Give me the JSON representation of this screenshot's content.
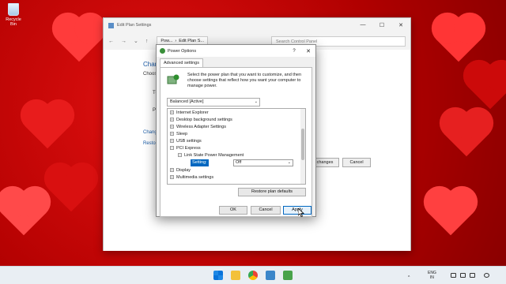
{
  "desktop": {
    "recycle_bin_label": "Recycle Bin"
  },
  "back_window": {
    "title": "Edit Plan Settings",
    "breadcrumb": [
      "Pow...",
      "Edit Plan S..."
    ],
    "nav_back": "←",
    "nav_forward": "→",
    "nav_down": "⌄",
    "nav_up": "↑",
    "search_placeholder": "Search Control Panel",
    "heading_partial": "Chan",
    "choose_partial": "Choos",
    "row1_partial": "Tu",
    "row2_partial": "Pu",
    "link1_partial": "Chang",
    "link2_partial": "Resto",
    "save_partial": "changes",
    "cancel": "Cancel",
    "min": "—",
    "max": "☐",
    "close": "✕"
  },
  "dialog": {
    "title": "Power Options",
    "help": "?",
    "close": "✕",
    "tab": "Advanced settings",
    "description": "Select the power plan that you want to customize, and then choose settings that reflect how you want your computer to manage power.",
    "plan": "Balanced [Active]",
    "tree": [
      {
        "exp": "+",
        "label": "Internet Explorer"
      },
      {
        "exp": "+",
        "label": "Desktop background settings"
      },
      {
        "exp": "+",
        "label": "Wireless Adapter Settings"
      },
      {
        "exp": "+",
        "label": "Sleep"
      },
      {
        "exp": "+",
        "label": "USB settings"
      },
      {
        "exp": "−",
        "label": "PCI Express"
      },
      {
        "exp": "−",
        "label": "Link State Power Management"
      },
      {
        "exp": "+",
        "label": "Display"
      },
      {
        "exp": "+",
        "label": "Multimedia settings"
      }
    ],
    "setting_label": "Setting:",
    "setting_value": "Off",
    "restore": "Restore plan defaults",
    "ok": "OK",
    "cancel": "Cancel",
    "apply": "Apply"
  },
  "taskbar": {
    "lang_top": "ENG",
    "lang_bottom": "IN"
  },
  "colors": {
    "accent": "#0067c0",
    "wallpaper": "#c80000"
  }
}
